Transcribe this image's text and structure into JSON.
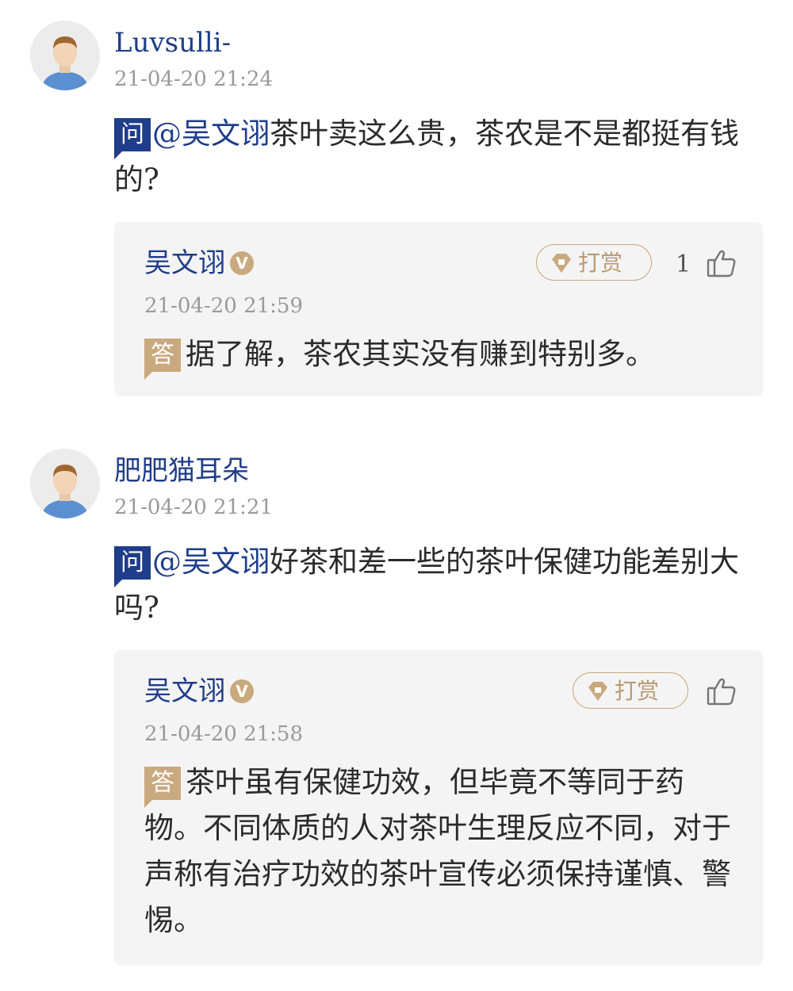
{
  "threads": [
    {
      "user": "Luvsulli-",
      "time": "21-04-20 21:24",
      "q_badge": "问",
      "mention": "@吴文诩",
      "question": "茶叶卖这么贵，茶农是不是都挺有钱的?",
      "answer": {
        "name": "吴文诩",
        "verified": "V",
        "tip_label": "打赏",
        "likes": "1",
        "time": "21-04-20 21:59",
        "a_badge": "答",
        "text": "据了解，茶农其实没有赚到特别多。"
      }
    },
    {
      "user": "肥肥猫耳朵",
      "time": "21-04-20 21:21",
      "q_badge": "问",
      "mention": "@吴文诩",
      "question": "好茶和差一些的茶叶保健功能差别大吗?",
      "answer": {
        "name": "吴文诩",
        "verified": "V",
        "tip_label": "打赏",
        "likes": "",
        "time": "21-04-20 21:58",
        "a_badge": "答",
        "text": "茶叶虽有保健功效，但毕竟不等同于药物。不同体质的人对茶叶生理反应不同，对于声称有治疗功效的茶叶宣传必须保持谨慎、警惕。"
      }
    }
  ],
  "icons": {
    "avatar": "default-avatar-icon",
    "tip": "diamond-icon",
    "like": "thumbs-up-icon",
    "verified": "verified-badge-icon"
  },
  "colors": {
    "brand_blue": "#1f3d8a",
    "gold": "#c9a97e",
    "card_bg": "#f4f4f4",
    "muted": "#9a9a9a"
  }
}
